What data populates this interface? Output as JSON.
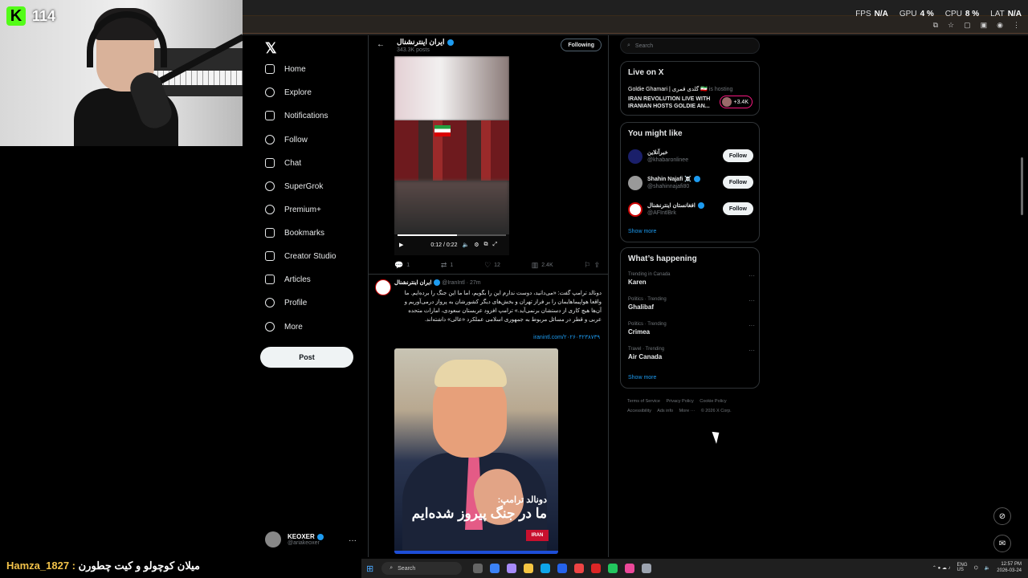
{
  "overlay": {
    "kick_count": "114",
    "stats": {
      "fps_label": "FPS",
      "fps": "N/A",
      "gpu_label": "GPU",
      "gpu": "4 %",
      "cpu_label": "CPU",
      "cpu": "8 %",
      "lat_label": "LAT",
      "lat": "N/A"
    },
    "chat_user": "Hamza_1827",
    "chat_sep": " : ",
    "chat_msg": "میلان کوچولو و کیت چطورن"
  },
  "nav": {
    "items": [
      {
        "label": "Home",
        "icon": "home-icon"
      },
      {
        "label": "Explore",
        "icon": "search-icon"
      },
      {
        "label": "Notifications",
        "icon": "bell-icon"
      },
      {
        "label": "Follow",
        "icon": "person-plus-icon"
      },
      {
        "label": "Chat",
        "icon": "envelope-icon"
      },
      {
        "label": "SuperGrok",
        "icon": "grok-icon"
      },
      {
        "label": "Premium+",
        "icon": "check-circle-icon"
      },
      {
        "label": "Bookmarks",
        "icon": "bookmark-icon"
      },
      {
        "label": "Creator Studio",
        "icon": "rocket-icon"
      },
      {
        "label": "Articles",
        "icon": "article-icon"
      },
      {
        "label": "Profile",
        "icon": "person-icon"
      },
      {
        "label": "More",
        "icon": "more-circle-icon"
      }
    ],
    "post": "Post",
    "account": {
      "name": "KEOXER",
      "handle": "@ariakeoxer"
    }
  },
  "timeline": {
    "header": {
      "title": "ایران اینترنشنال",
      "subtitle": "343.3K posts",
      "following": "Following"
    },
    "video": {
      "time": "0:12 / 0:22",
      "progress": 0.55
    },
    "tweet1_actions": {
      "replies": "1",
      "reposts": "1",
      "likes": "12",
      "views": "2.4K"
    },
    "tweet2": {
      "name": "ایران اینترنشنال",
      "handle": "@IranIntl",
      "time": "· 27m",
      "text": "دونالد ترامپ گفت: «می‌دانید، دوست ندارم این را بگویم، اما ما این جنگ را برده‌ایم. ما واقعا هواپیماهایمان را بر فراز تهران و بخش‌های دیگر کشورشان به پرواز درمی‌آوریم و آن‌ها هیچ کاری از دستشان برنمی‌آید.» ترامپ افزود عربستان سعودی، امارات متحده عربی و قطر در مسائل مربوط به جمهوری اسلامی عملکرد «عالی» داشته‌اند.",
      "link": "iranintl.com/۲۰۲۶۰۳۲۳۸۷۳۹",
      "caption1": "دونالد ترامپ:",
      "caption2": "ما در جنگ پیروز شده‌ایم",
      "badge": "IRAN"
    }
  },
  "right": {
    "search_placeholder": "Search",
    "live": {
      "title": "Live on X",
      "host": "Goldie Ghamari | گلدی قمری 🇮🇷",
      "hosting": "is hosting",
      "space_title": "IRAN REVOLUTION LIVE WITH IRANIAN HOSTS GOLDIE AN...",
      "count": "+3.4K"
    },
    "you_might_like": {
      "title": "You might like",
      "users": [
        {
          "name": "خبرآنلاین",
          "handle": "@khabaronlinee",
          "button": "Follow"
        },
        {
          "name": "Shahin Najafi ☠️",
          "handle": "@shahinnajafi80",
          "button": "Follow"
        },
        {
          "name": "افغانستان اینترنشنال",
          "handle": "@AFIntlBrk",
          "button": "Follow"
        }
      ],
      "show_more": "Show more"
    },
    "happening": {
      "title": "What’s happening",
      "trends": [
        {
          "category": "Trending in Canada",
          "title": "Karen"
        },
        {
          "category": "Politics · Trending",
          "title": "Ghalibaf"
        },
        {
          "category": "Politics · Trending",
          "title": "Crimea"
        },
        {
          "category": "Travel · Trending",
          "title": "Air Canada"
        }
      ],
      "show_more": "Show more"
    },
    "footer": [
      "Terms of Service",
      "Privacy Policy",
      "Cookie Policy",
      "Accessibility",
      "Ads info",
      "More ···",
      "© 2026 X Corp."
    ]
  },
  "taskbar": {
    "search": "Search",
    "lang": "ENG",
    "region": "US",
    "time": "12:57 PM",
    "date": "2026-03-24"
  }
}
